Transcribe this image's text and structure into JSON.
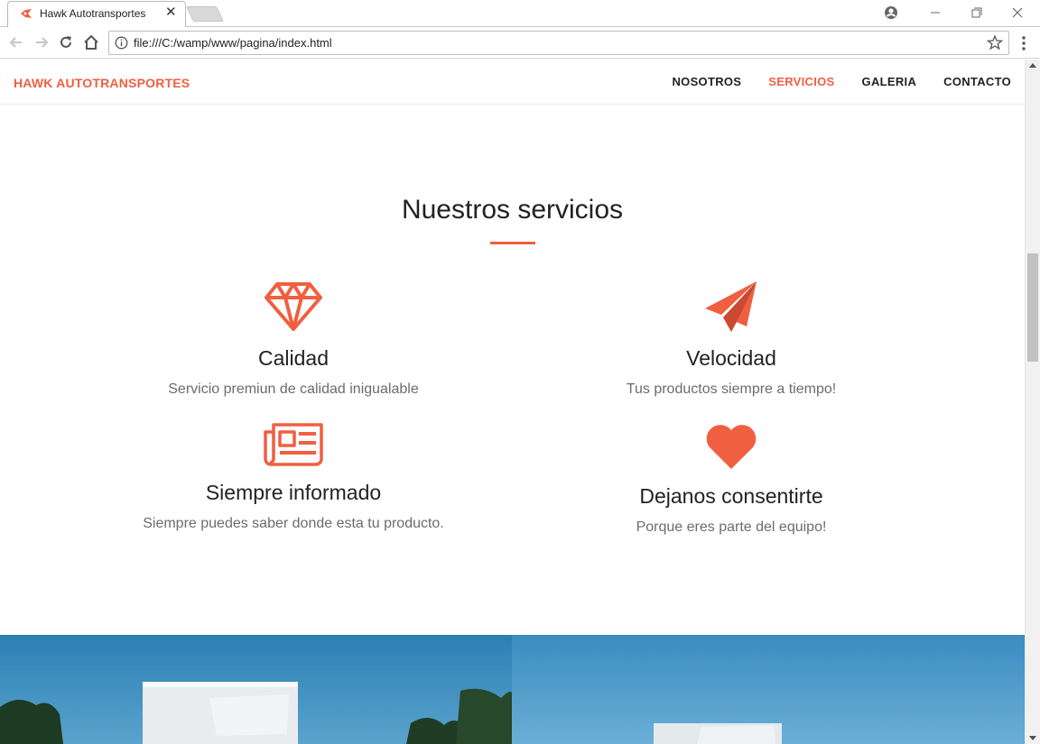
{
  "browser": {
    "tab_title": "Hawk Autotransportes",
    "url": "file:///C:/wamp/www/pagina/index.html"
  },
  "site": {
    "brand": "Hawk Autotransportes",
    "nav": [
      {
        "label": "Nosotros",
        "active": false
      },
      {
        "label": "Servicios",
        "active": true
      },
      {
        "label": "Galeria",
        "active": false
      },
      {
        "label": "Contacto",
        "active": false
      }
    ],
    "accent_color": "#f05f40"
  },
  "services": {
    "heading": "Nuestros servicios",
    "items": [
      {
        "icon": "diamond-icon",
        "title": "Calidad",
        "text": "Servicio premiun de calidad inigualable"
      },
      {
        "icon": "paper-plane-icon",
        "title": "Velocidad",
        "text": "Tus productos siempre a tiempo!"
      },
      {
        "icon": "newspaper-icon",
        "title": "Siempre informado",
        "text": "Siempre puedes saber donde esta tu producto."
      },
      {
        "icon": "heart-icon",
        "title": "Dejanos consentirte",
        "text": "Porque eres parte del equipo!"
      }
    ]
  }
}
